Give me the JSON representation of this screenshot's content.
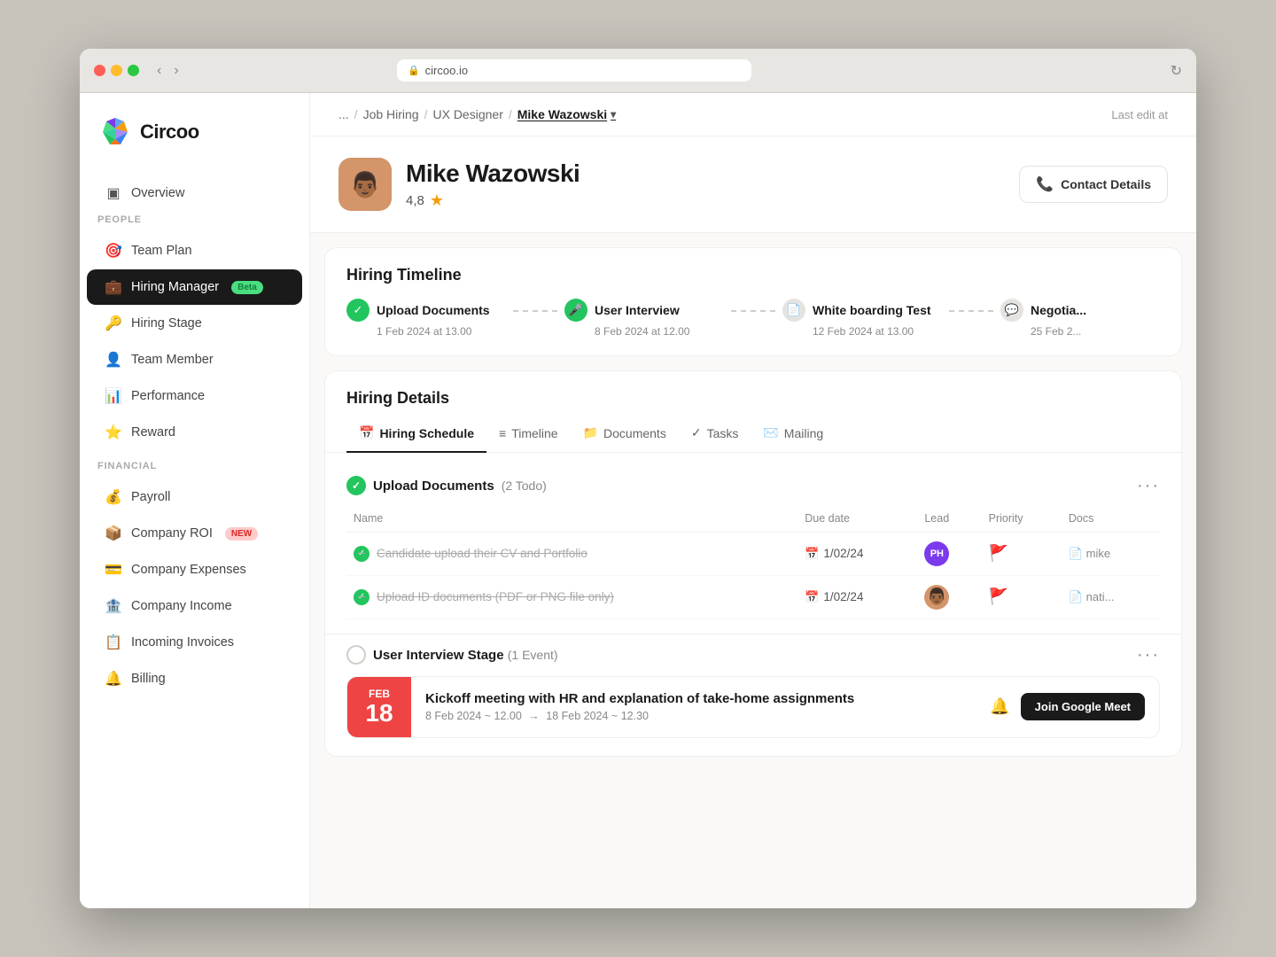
{
  "browser": {
    "url": "circoo.io",
    "traffic_lights": [
      "red",
      "yellow",
      "green"
    ]
  },
  "sidebar": {
    "logo_text": "Circoo",
    "overview_label": "Overview",
    "people_section": "PEOPLE",
    "financial_section": "FINANCIAL",
    "items_people": [
      {
        "id": "team-plan",
        "label": "Team Plan",
        "icon": "🎯"
      },
      {
        "id": "hiring-manager",
        "label": "Hiring Manager",
        "icon": "💼",
        "badge": "Beta"
      },
      {
        "id": "hiring-stage",
        "label": "Hiring Stage",
        "icon": "🔑"
      },
      {
        "id": "team-member",
        "label": "Team Member",
        "icon": "👤"
      },
      {
        "id": "performance",
        "label": "Performance",
        "icon": "📊"
      },
      {
        "id": "reward",
        "label": "Reward",
        "icon": "⭐"
      }
    ],
    "items_financial": [
      {
        "id": "payroll",
        "label": "Payroll",
        "icon": "💰"
      },
      {
        "id": "company-roi",
        "label": "Company ROI",
        "icon": "📦",
        "badge": "NEW"
      },
      {
        "id": "company-expenses",
        "label": "Company Expenses",
        "icon": "💳"
      },
      {
        "id": "company-income",
        "label": "Company Income",
        "icon": "🏦"
      },
      {
        "id": "incoming-invoices",
        "label": "Incoming Invoices",
        "icon": "📋"
      },
      {
        "id": "billing",
        "label": "Billing",
        "icon": "🔔"
      }
    ]
  },
  "breadcrumb": {
    "ellipsis": "...",
    "job_hiring": "Job Hiring",
    "ux_designer": "UX Designer",
    "current": "Mike Wazowski",
    "last_edit": "Last edit at"
  },
  "profile": {
    "name": "Mike Wazowski",
    "rating": "4,8",
    "contact_details_label": "Contact Details",
    "avatar_emoji": "👨🏾"
  },
  "hiring_timeline": {
    "title": "Hiring Timeline",
    "steps": [
      {
        "id": "upload-docs",
        "name": "Upload Documents",
        "date": "1 Feb 2024 at 13.00",
        "status": "done",
        "icon": "✓"
      },
      {
        "id": "user-interview",
        "name": "User Interview",
        "date": "8 Feb 2024 at 12.00",
        "status": "active",
        "icon": "🎤"
      },
      {
        "id": "whiteboard-test",
        "name": "White boarding Test",
        "date": "12 Feb 2024 at 13.00",
        "status": "pending",
        "icon": "📄"
      },
      {
        "id": "negotiation",
        "name": "Negotia...",
        "date": "25 Feb 2...",
        "status": "pending",
        "icon": "💬"
      }
    ]
  },
  "hiring_details": {
    "title": "Hiring Details",
    "tabs": [
      {
        "id": "hiring-schedule",
        "label": "Hiring Schedule",
        "icon": "📅",
        "active": true
      },
      {
        "id": "timeline",
        "label": "Timeline",
        "icon": "≡"
      },
      {
        "id": "documents",
        "label": "Documents",
        "icon": "📁"
      },
      {
        "id": "tasks",
        "label": "Tasks",
        "icon": "✓"
      },
      {
        "id": "mailing",
        "label": "Mailing",
        "icon": "✉️"
      }
    ],
    "task_groups": [
      {
        "id": "upload-documents",
        "name": "Upload Documents",
        "count": "2 Todo",
        "status": "done",
        "columns": [
          "Name",
          "Due date",
          "Lead",
          "Priority",
          "Docs"
        ],
        "tasks": [
          {
            "name": "Candidate upload their CV and Portfolio",
            "due_date": "1/02/24",
            "lead_initials": "PH",
            "lead_color": "#7c3aed",
            "priority": "🚩",
            "priority_color": "#ef4444",
            "doc": "mike"
          },
          {
            "name": "Upload ID documents (PDF or PNG file only)",
            "due_date": "1/02/24",
            "lead_avatar": true,
            "lead_color": "#d4956a",
            "priority": "🚩",
            "priority_color": "#f59e0b",
            "doc": "nati..."
          }
        ]
      }
    ],
    "stage": {
      "name": "User Interview Stage",
      "count": "1 Event"
    },
    "event": {
      "month": "Feb",
      "day": "18",
      "title": "Kickoff meeting with HR and explanation of take-home assignments",
      "time_start": "8 Feb 2024 ~ 12.00",
      "time_arrow": "→",
      "time_end": "18 Feb 2024 ~ 12.30",
      "join_label": "Join Google Meet"
    }
  }
}
